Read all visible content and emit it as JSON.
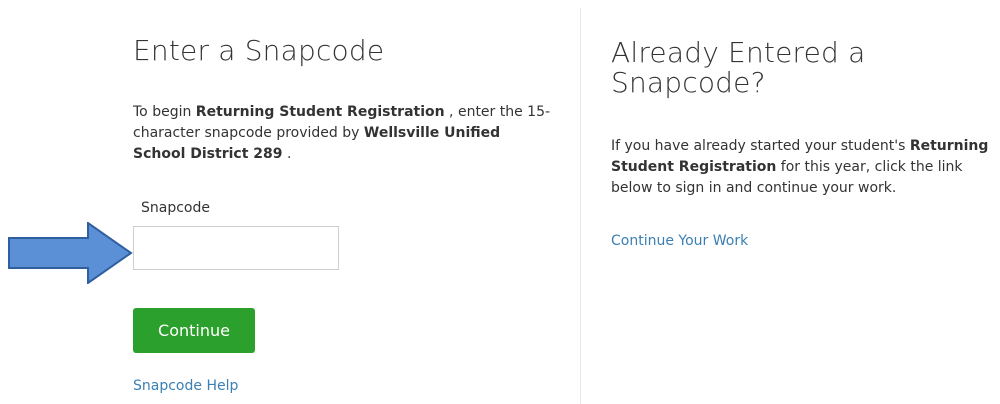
{
  "left": {
    "title": "Enter a Snapcode",
    "intro": {
      "prefix": "To begin ",
      "registration": "Returning Student Registration",
      "middle": " , enter the 15-character snapcode provided by ",
      "district": "Wellsville Unified School District 289",
      "suffix": " ."
    },
    "field_label": "Snapcode",
    "input_value": "",
    "continue_label": "Continue",
    "help_link": "Snapcode Help"
  },
  "right": {
    "title": "Already Entered a Snapcode?",
    "text": {
      "prefix": "If you have already started your student's ",
      "registration": "Returning Student Registration",
      "suffix": " for this year, click the link below to sign in and continue your work."
    },
    "continue_link": "Continue Your Work"
  },
  "colors": {
    "button": "#2ca02c",
    "link": "#3b7fb3",
    "arrow_fill": "#5b8fd6",
    "arrow_stroke": "#2f5f9f"
  },
  "icons": {
    "pointer": "arrow-right-icon"
  }
}
